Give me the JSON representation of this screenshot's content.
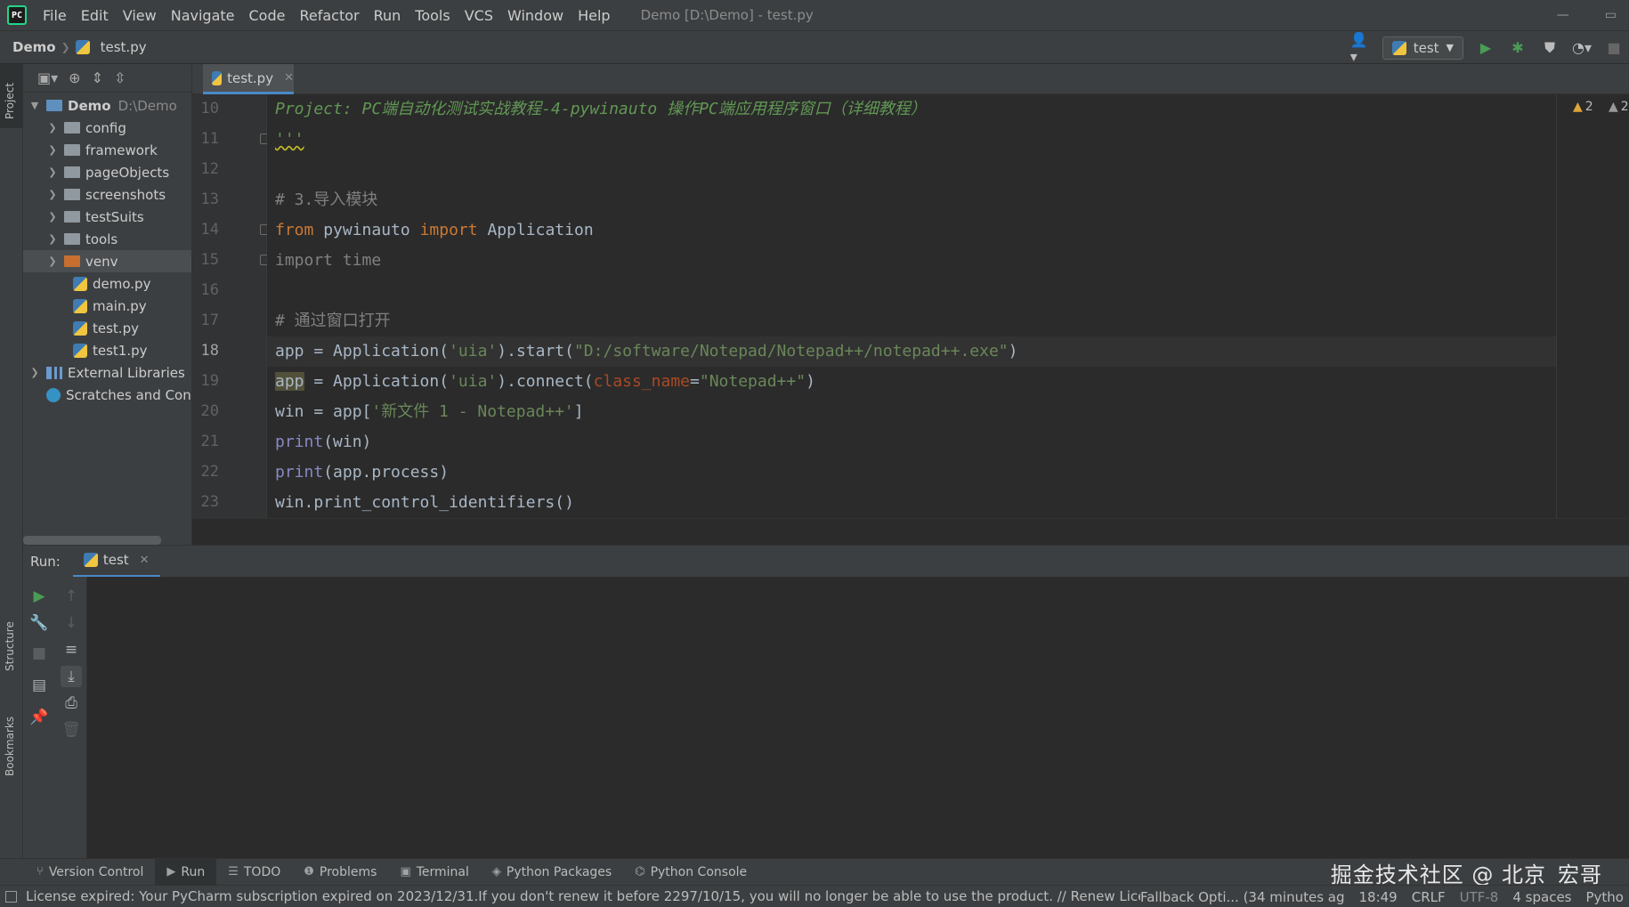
{
  "menubar": {
    "items": [
      "File",
      "Edit",
      "View",
      "Navigate",
      "Code",
      "Refactor",
      "Run",
      "Tools",
      "VCS",
      "Window",
      "Help"
    ],
    "window_title": "Demo [D:\\Demo] - test.py"
  },
  "breadcrumb": {
    "project": "Demo",
    "file": "test.py"
  },
  "toolbar": {
    "run_config": "test"
  },
  "project_tree": {
    "root": {
      "name": "Demo",
      "path": "D:\\Demo"
    },
    "folders": [
      "config",
      "framework",
      "pageObjects",
      "screenshots",
      "testSuits",
      "tools",
      "venv"
    ],
    "files": [
      "demo.py",
      "main.py",
      "test.py",
      "test1.py"
    ],
    "external_libraries": "External Libraries",
    "scratches": "Scratches and Con"
  },
  "left_stripe": {
    "project": "Project",
    "structure": "Structure",
    "bookmarks": "Bookmarks"
  },
  "editor": {
    "tab": "test.py",
    "line_numbers": [
      "10",
      "11",
      "12",
      "13",
      "14",
      "15",
      "16",
      "17",
      "18",
      "19",
      "20",
      "21",
      "22",
      "23"
    ],
    "current_line": "18",
    "lines": {
      "l10": "Project: PC端自动化测试实战教程-4-pywinauto 操作PC端应用程序窗口（详细教程）",
      "l11": "'''",
      "l13": "# 3.导入模块",
      "l14_kw1": "from",
      "l14_mod": " pywinauto ",
      "l14_kw2": "import",
      "l14_rest": " Application",
      "l15_kw": "import",
      "l15_rest": " time",
      "l17": "# 通过窗口打开",
      "l18_a": "app = Application(",
      "l18_s1": "'uia'",
      "l18_b": ").start(",
      "l18_s2": "\"D:/software/Notepad/Notepad++/notepad++.exe\"",
      "l18_c": ")",
      "l19_hl": "app",
      "l19_a": " = Application(",
      "l19_s1": "'uia'",
      "l19_b": ").connect(",
      "l19_param": "class_name",
      "l19_eq": "=",
      "l19_s2": "\"Notepad++\"",
      "l19_c": ")",
      "l20_a": "win = app[",
      "l20_s": "'新文件 1 - Notepad++'",
      "l20_b": "]",
      "l21_fn": "print",
      "l21_rest": "(win)",
      "l22_fn": "print",
      "l22_rest": "(app.process)",
      "l23": "win.print_control_identifiers()"
    },
    "warnings": [
      "2",
      "2"
    ]
  },
  "run_panel": {
    "label": "Run:",
    "tab": "test"
  },
  "tool_tabs": [
    "Version Control",
    "Run",
    "TODO",
    "Problems",
    "Terminal",
    "Python Packages",
    "Python Console"
  ],
  "watermark": "掘金技术社区 @ 北京_宏哥",
  "status": {
    "message": "License expired: Your PyCharm subscription expired on 2023/12/31.If you don't renew it before 2297/10/15, you will no longer be able to use the product. // Renew License",
    "fallback": "Fallback Opti... (34 minutes ag",
    "position": "18:49",
    "line_sep": "CRLF",
    "encoding": "UTF-8",
    "indent": "4 spaces",
    "interpreter": "Pytho"
  },
  "colors": {
    "accent": "#4a88c7",
    "keyword": "#cc7832",
    "string": "#6a8759",
    "docstring": "#629755",
    "comment": "#808080"
  }
}
